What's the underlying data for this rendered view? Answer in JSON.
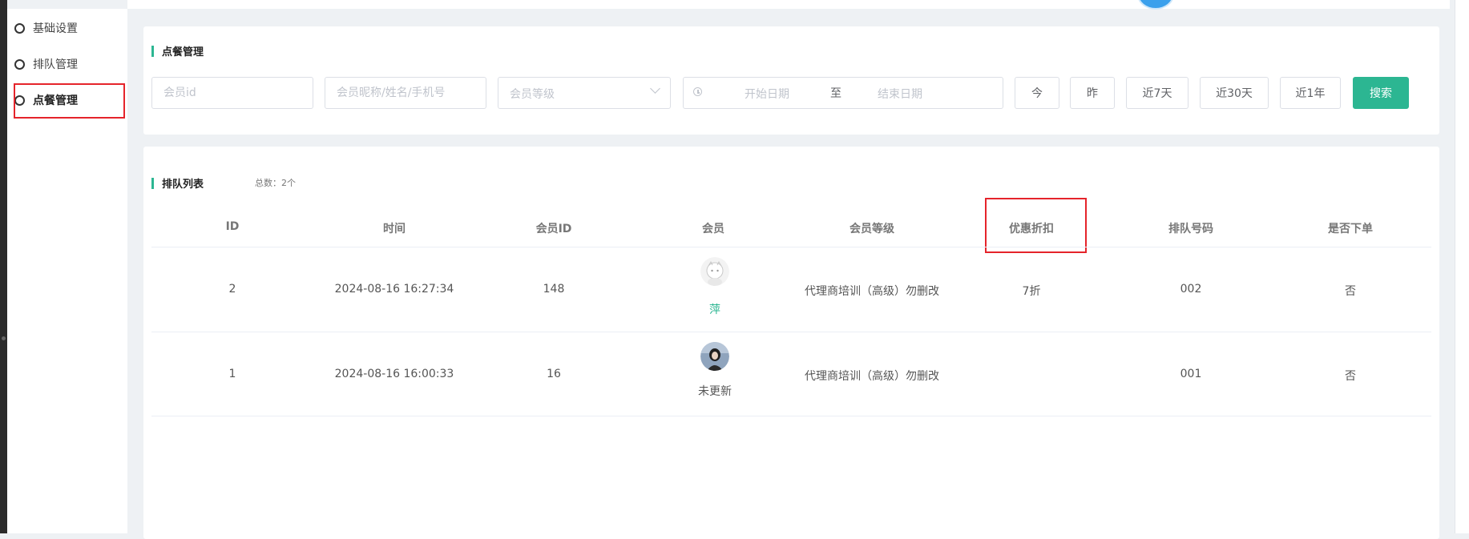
{
  "sidebar": {
    "items": [
      {
        "label": "基础设置"
      },
      {
        "label": "排队管理"
      },
      {
        "label": "点餐管理"
      }
    ]
  },
  "filter": {
    "title": "点餐管理",
    "member_id_placeholder": "会员id",
    "member_info_placeholder": "会员昵称/姓名/手机号",
    "level_placeholder": "会员等级",
    "start_date_placeholder": "开始日期",
    "date_separator": "至",
    "end_date_placeholder": "结束日期",
    "buttons": {
      "today": "今",
      "yesterday": "昨",
      "last7": "近7天",
      "last30": "近30天",
      "last1y": "近1年",
      "search": "搜索"
    }
  },
  "list": {
    "title": "排队列表",
    "total": "总数：2个",
    "columns": [
      "ID",
      "时间",
      "会员ID",
      "会员",
      "会员等级",
      "优惠折扣",
      "排队号码",
      "是否下单"
    ],
    "rows": [
      {
        "id": "2",
        "time": "2024-08-16 16:27:34",
        "member_id": "148",
        "member_name": "萍",
        "level": "代理商培训（高级）勿删改",
        "discount": "7折",
        "queue_no": "002",
        "ordered": "否"
      },
      {
        "id": "1",
        "time": "2024-08-16 16:00:33",
        "member_id": "16",
        "member_name": "未更新",
        "level": "代理商培训（高级）勿删改",
        "discount": "",
        "queue_no": "001",
        "ordered": "否"
      }
    ]
  },
  "colors": {
    "accent": "#2cb692",
    "highlight": "#e5242b"
  }
}
